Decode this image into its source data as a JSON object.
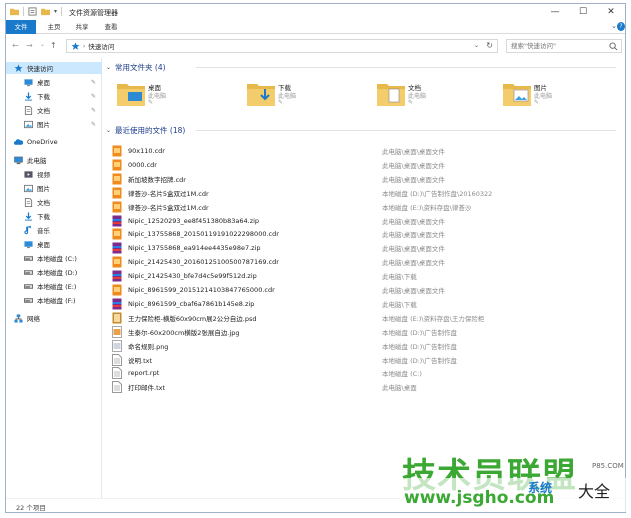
{
  "window": {
    "title": "文件资源管理器"
  },
  "ribbon": {
    "tabs": [
      "文件",
      "主页",
      "共享",
      "查看"
    ]
  },
  "address": {
    "location": "快速访问",
    "search_placeholder": "搜索\"快速访问\""
  },
  "sidebar": {
    "items": [
      {
        "label": "快速访问",
        "icon": "star-icon",
        "indent": 0,
        "selected": true
      },
      {
        "label": "桌面",
        "icon": "desktop-icon",
        "indent": 1,
        "pinned": true
      },
      {
        "label": "下载",
        "icon": "download-icon",
        "indent": 1,
        "pinned": true
      },
      {
        "label": "文档",
        "icon": "document-icon",
        "indent": 1,
        "pinned": true
      },
      {
        "label": "图片",
        "icon": "picture-icon",
        "indent": 1,
        "pinned": true
      },
      {
        "label": "OneDrive",
        "icon": "cloud-icon",
        "indent": 0
      },
      {
        "label": "此电脑",
        "icon": "computer-icon",
        "indent": 0
      },
      {
        "label": "视频",
        "icon": "video-icon",
        "indent": 1
      },
      {
        "label": "图片",
        "icon": "picture-icon",
        "indent": 1
      },
      {
        "label": "文档",
        "icon": "document-icon",
        "indent": 1
      },
      {
        "label": "下载",
        "icon": "download-icon",
        "indent": 1
      },
      {
        "label": "音乐",
        "icon": "music-icon",
        "indent": 1
      },
      {
        "label": "桌面",
        "icon": "desktop-icon",
        "indent": 1
      },
      {
        "label": "本地磁盘 (C:)",
        "icon": "drive-icon",
        "indent": 1
      },
      {
        "label": "本地磁盘 (D:)",
        "icon": "drive-icon",
        "indent": 1
      },
      {
        "label": "本地磁盘 (E:)",
        "icon": "drive-icon",
        "indent": 1
      },
      {
        "label": "本地磁盘 (F:)",
        "icon": "drive-icon",
        "indent": 1
      },
      {
        "label": "网络",
        "icon": "network-icon",
        "indent": 0
      }
    ]
  },
  "frequent": {
    "header": "常用文件夹 (4)",
    "folders": [
      {
        "name": "桌面",
        "sub": "此电脑",
        "icon": "desktop-folder-icon"
      },
      {
        "name": "下载",
        "sub": "此电脑",
        "icon": "download-folder-icon"
      },
      {
        "name": "文档",
        "sub": "此电脑",
        "icon": "document-folder-icon"
      },
      {
        "name": "图片",
        "sub": "此电脑",
        "icon": "picture-folder-icon"
      }
    ]
  },
  "recent": {
    "header": "最近使用的文件 (18)",
    "files": [
      {
        "name": "90x110.cdr",
        "path": "此电脑\\桌面\\桌面文件",
        "type": "cdr"
      },
      {
        "name": "0000.cdr",
        "path": "此电脑\\桌面\\桌面文件",
        "type": "cdr"
      },
      {
        "name": "新加坡数字招牌.cdr",
        "path": "此电脑\\桌面\\桌面文件",
        "type": "cdr"
      },
      {
        "name": "律荟沙-名片5盒双过1M.cdr",
        "path": "本地磁盘 (D:)\\广告制作盘\\20160322",
        "type": "cdr"
      },
      {
        "name": "律荟沙-名片5盒双过1M.cdr",
        "path": "本地磁盘 (E:)\\资料存盘\\律荟沙",
        "type": "cdr"
      },
      {
        "name": "Nipic_12520293_ee8f451380b83a64.zip",
        "path": "此电脑\\桌面\\桌面文件",
        "type": "zip"
      },
      {
        "name": "Nipic_13755868_20150119191022298000.cdr",
        "path": "此电脑\\桌面\\桌面文件",
        "type": "cdr"
      },
      {
        "name": "Nipic_13755868_ea914ee4435e98e7.zip",
        "path": "此电脑\\桌面\\桌面文件",
        "type": "zip"
      },
      {
        "name": "Nipic_21425430_20160125100500787169.cdr",
        "path": "此电脑\\桌面\\桌面文件",
        "type": "cdr"
      },
      {
        "name": "Nipic_21425430_bfe7d4c5e99f512d.zip",
        "path": "此电脑\\下载",
        "type": "zip"
      },
      {
        "name": "Nipic_8961599_20151214103847765000.cdr",
        "path": "此电脑\\桌面\\桌面文件",
        "type": "cdr"
      },
      {
        "name": "Nipic_8961599_cbaf6a7861b145e8.zip",
        "path": "此电脑\\下载",
        "type": "zip"
      },
      {
        "name": "王力保险柜-横版60x90cm展2公分自边.psd",
        "path": "本地磁盘 (E:)\\资料存盘\\王力保险柜",
        "type": "psd"
      },
      {
        "name": "生泰尔-60x200cm横版2张展自边.jpg",
        "path": "本地磁盘 (D:)\\广告制作盘",
        "type": "jpg"
      },
      {
        "name": "命名规则.png",
        "path": "本地磁盘 (D:)\\广告制作盘",
        "type": "png"
      },
      {
        "name": "说明.txt",
        "path": "本地磁盘 (D:)\\广告制作盘",
        "type": "txt"
      },
      {
        "name": "report.rpt",
        "path": "本地磁盘 (C:)",
        "type": "txt"
      },
      {
        "name": "打印邮件.txt",
        "path": "此电脑\\桌面",
        "type": "txt"
      }
    ]
  },
  "status": {
    "count": "22 个项目"
  },
  "watermark": {
    "line1": "技术员联盟",
    "line2": "www.jsgho.com",
    "brand_small": "P85.COM",
    "brand_big": "大全",
    "brand_mid": "系统"
  },
  "colors": {
    "accent": "#1979ca",
    "selected": "#cce8ff",
    "folder": "#e8b84a",
    "watermark": "#3aa832"
  }
}
